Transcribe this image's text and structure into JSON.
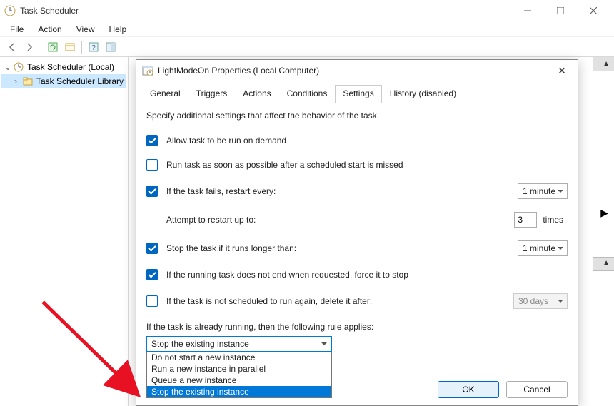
{
  "window": {
    "title": "Task Scheduler"
  },
  "menu": {
    "items": [
      "File",
      "Action",
      "View",
      "Help"
    ]
  },
  "tree": {
    "root": "Task Scheduler (Local)",
    "child": "Task Scheduler Library"
  },
  "dialog": {
    "title": "LightModeOn Properties (Local Computer)",
    "tabs": [
      "General",
      "Triggers",
      "Actions",
      "Conditions",
      "Settings",
      "History (disabled)"
    ],
    "active_tab": 4,
    "desc": "Specify additional settings that affect the behavior of the task.",
    "settings": {
      "on_demand": {
        "label": "Allow task to be run on demand",
        "checked": true
      },
      "run_asap": {
        "label": "Run task as soon as possible after a scheduled start is missed",
        "checked": false
      },
      "restart": {
        "label": "If the task fails, restart every:",
        "checked": true,
        "interval": "1 minute"
      },
      "restart_count": {
        "label": "Attempt to restart up to:",
        "value": "3",
        "suffix": "times"
      },
      "stop_long": {
        "label": "Stop the task if it runs longer than:",
        "checked": true,
        "value": "1 minute"
      },
      "force_stop": {
        "label": "If the running task does not end when requested, force it to stop",
        "checked": true
      },
      "delete_after": {
        "label": "If the task is not scheduled to run again, delete it after:",
        "checked": false,
        "value": "30 days"
      },
      "rule_label": "If the task is already running, then the following rule applies:",
      "rule_selected": "Stop the existing instance",
      "rule_options": [
        "Do not start a new instance",
        "Run a new instance in parallel",
        "Queue a new instance",
        "Stop the existing instance"
      ]
    },
    "buttons": {
      "ok": "OK",
      "cancel": "Cancel"
    }
  }
}
